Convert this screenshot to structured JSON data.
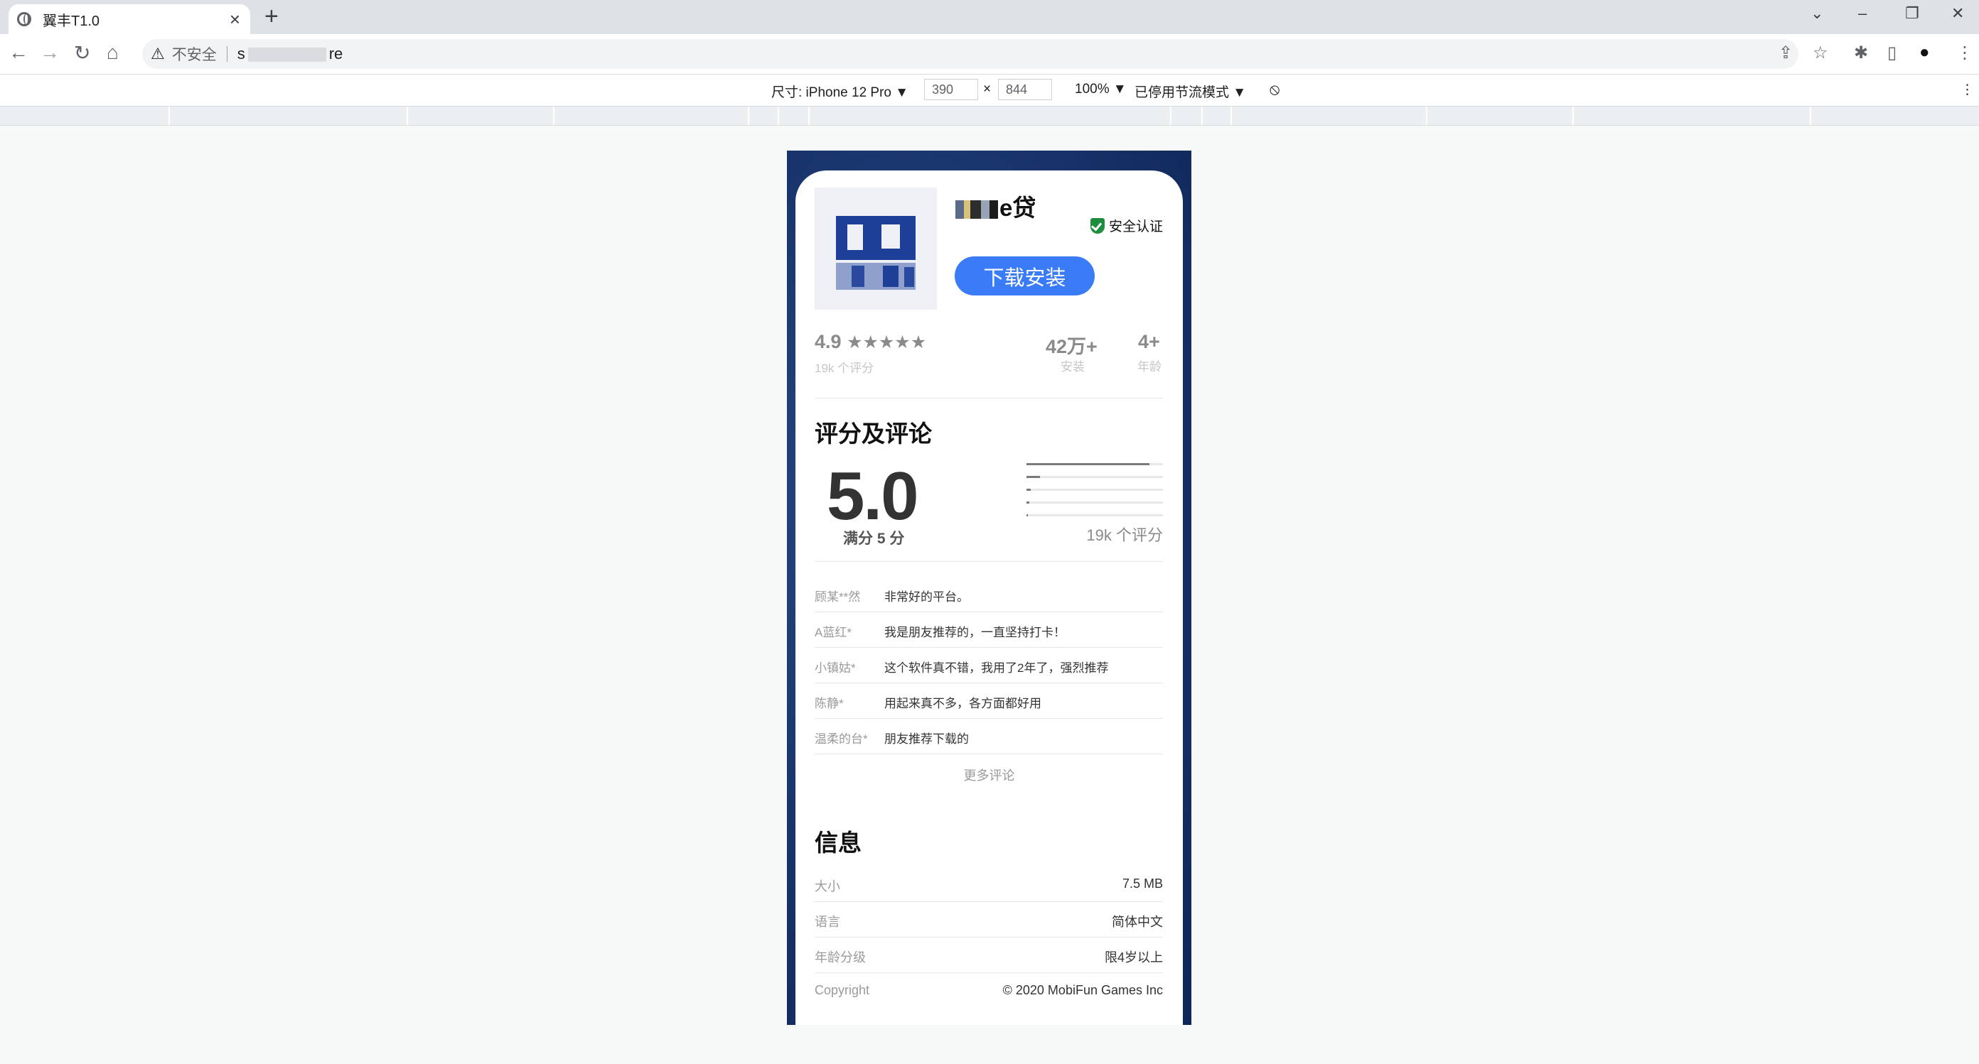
{
  "browser": {
    "tab_title": "翼丰T1.0",
    "tab_close": "×",
    "new_tab": "+",
    "minimize": "–",
    "restore": "❐",
    "close": "✕",
    "tab_list": "⌄",
    "security_label": "不安全",
    "url_start": "s",
    "url_end": "re"
  },
  "devtools": {
    "device_label": "尺寸: iPhone 12 Pro ▼",
    "width": "390",
    "times": "×",
    "height": "844",
    "zoom": "100% ▼",
    "throttle": "已停用节流模式 ▼",
    "more": "⋮"
  },
  "app": {
    "name_suffix": "e贷",
    "secure_label": "安全认证",
    "download_label": "下载安装",
    "rating_value": "4.9",
    "rating_stars": "★★★★★",
    "rating_count_label": "19k 个评分",
    "installs": "42万+",
    "installs_label": "安装",
    "age": "4+",
    "age_label": "年龄"
  },
  "ratings": {
    "heading": "评分及评论",
    "score": "5.0",
    "out_of": "满分 5 分",
    "distribution": [
      0.9,
      0.1,
      0.03,
      0.02,
      0.01
    ],
    "count": "19k 个评分"
  },
  "reviews": [
    {
      "user": "顾某**然",
      "text": "非常好的平台。"
    },
    {
      "user": "A蓝红*",
      "text": "我是朋友推荐的，一直坚持打卡！"
    },
    {
      "user": "小镇姑*",
      "text": "这个软件真不错，我用了2年了，强烈推荐"
    },
    {
      "user": "陈静*",
      "text": "用起来真不多，各方面都好用"
    },
    {
      "user": "温柔的台*",
      "text": "朋友推荐下载的"
    }
  ],
  "more_reviews": "更多评论",
  "info": {
    "heading": "信息",
    "rows": [
      {
        "key": "大小",
        "value": "7.5 MB"
      },
      {
        "key": "语言",
        "value": "简体中文"
      },
      {
        "key": "年龄分级",
        "value": "限4岁以上"
      },
      {
        "key": "Copyright",
        "value": "© 2020 MobiFun Games Inc"
      }
    ]
  }
}
